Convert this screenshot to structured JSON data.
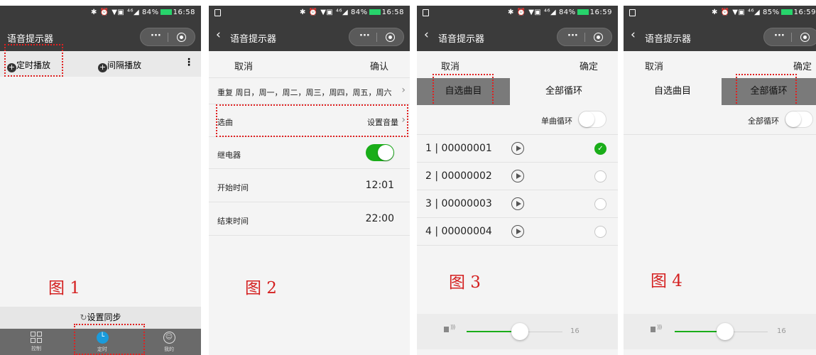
{
  "app_title": "语音提示器",
  "panel1": {
    "status_text": "84%",
    "time": "16:58",
    "tabs": [
      "定时播放",
      "间隔播放"
    ],
    "sync_label": "设置同步",
    "bottom_nav": [
      {
        "label": "控制",
        "icon": "grid-icon"
      },
      {
        "label": "定时",
        "icon": "clock-icon",
        "active": true
      },
      {
        "label": "我的",
        "icon": "user-icon"
      }
    ],
    "fig_label": "图 1"
  },
  "panel2": {
    "status_text": "84%",
    "time": "16:58",
    "cancel": "取消",
    "confirm": "确认",
    "repeat_label": "重复",
    "repeat_value": "周日，周一，周二，周三，周四，周五，周六",
    "song_label": "选曲",
    "song_value": "设置音量",
    "relay_label": "继电器",
    "relay_on": true,
    "start_label": "开始时间",
    "start_value": "12:01",
    "end_label": "结束时间",
    "end_value": "22:00",
    "fig_label": "图 2"
  },
  "panel3": {
    "status_text": "84%",
    "time": "16:59",
    "cancel": "取消",
    "confirm": "确定",
    "tab_custom": "自选曲目",
    "tab_all": "全部循环",
    "single_loop_label": "单曲循环",
    "tracks": [
      {
        "num": "1",
        "name": "00000001",
        "selected": true
      },
      {
        "num": "2",
        "name": "00000002",
        "selected": false
      },
      {
        "num": "3",
        "name": "00000003",
        "selected": false
      },
      {
        "num": "4",
        "name": "00000004",
        "selected": false
      }
    ],
    "volume": "16",
    "fig_label": "图 3"
  },
  "panel4": {
    "status_text": "85%",
    "time": "16:59",
    "cancel": "取消",
    "confirm": "确定",
    "tab_custom": "自选曲目",
    "tab_all": "全部循环",
    "all_loop_label": "全部循环",
    "volume": "16",
    "fig_label": "图 4"
  },
  "colors": {
    "accent_green": "#1aad19",
    "nav_dark": "#3b3b3b",
    "annotation_red": "#e02020",
    "tab_active_gray": "#7a7a7a"
  }
}
